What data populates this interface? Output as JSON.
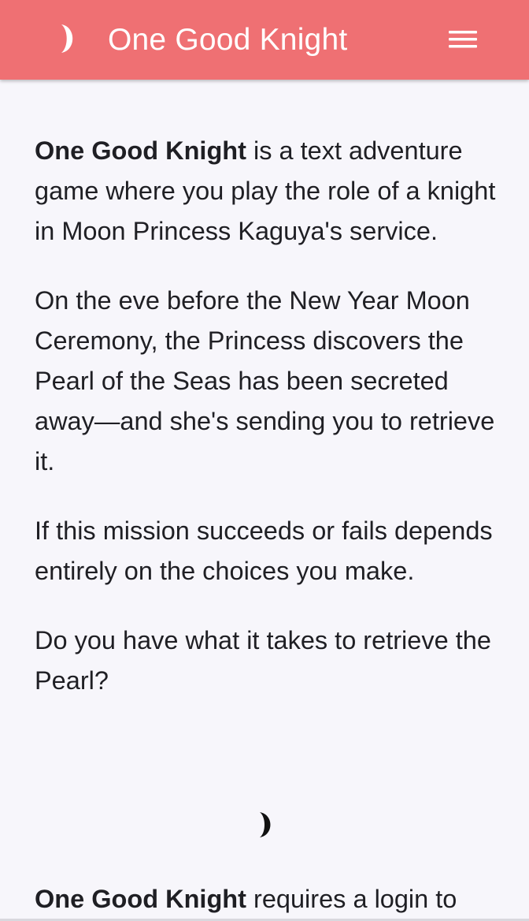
{
  "header": {
    "title": "One Good Knight",
    "logo_icon": "crescent-moon-icon",
    "menu_icon": "hamburger-menu-icon",
    "background_color": "#ef7073",
    "text_color": "#ffffff"
  },
  "intro": {
    "p1_bold": "One Good Knight",
    "p1_text": " is a text adventure game where you play the role of a knight in Moon Princess Kaguya's service.",
    "p2": "On the eve before the New Year Moon Ceremony, the Princess discovers the Pearl of the Seas has been secreted away—and she's sending you to retrieve it.",
    "p3": "If this mission succeeds or fails depends entirely on the choices you make.",
    "p4": "Do you have what it takes to retrieve the Pearl?"
  },
  "divider": {
    "icon": "crescent-moon-divider-icon"
  },
  "login_notice": {
    "bold": "One Good Knight",
    "text": " requires a login to"
  },
  "colors": {
    "page_background": "#f7f6fb",
    "body_text": "#1f1f24"
  }
}
